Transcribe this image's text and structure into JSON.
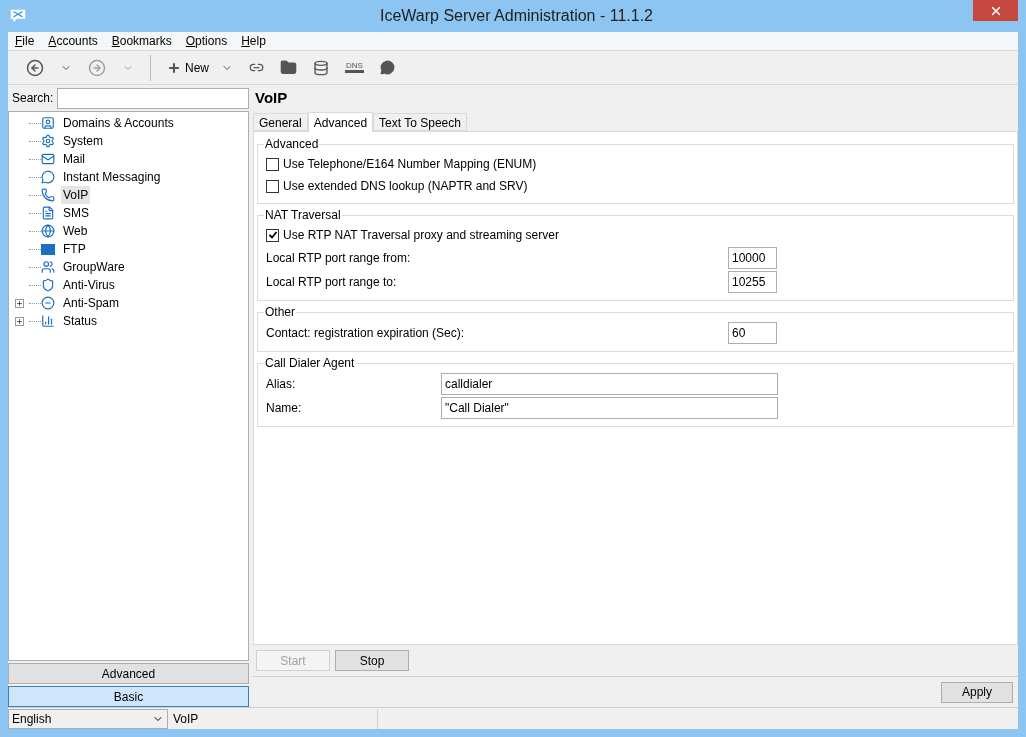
{
  "window": {
    "title": "IceWarp Server Administration - 11.1.2"
  },
  "menu": [
    "File",
    "Accounts",
    "Bookmarks",
    "Options",
    "Help"
  ],
  "toolbar": [
    {
      "kind": "back",
      "disabled": false
    },
    {
      "kind": "dropdown",
      "disabled": false
    },
    {
      "kind": "forward",
      "disabled": true
    },
    {
      "kind": "dropdown",
      "disabled": true
    },
    {
      "kind": "separator"
    },
    {
      "kind": "new",
      "label": "New",
      "disabled": false
    },
    {
      "kind": "dropdown",
      "disabled": false
    },
    {
      "kind": "link",
      "disabled": false
    },
    {
      "kind": "folder",
      "disabled": false
    },
    {
      "kind": "database",
      "disabled": false
    },
    {
      "kind": "dns",
      "label": "DNS",
      "disabled": false
    },
    {
      "kind": "chat",
      "disabled": false
    }
  ],
  "search": {
    "label": "Search:"
  },
  "tree": [
    {
      "label": "Domains & Accounts",
      "selected": false
    },
    {
      "label": "System",
      "selected": false
    },
    {
      "label": "Mail",
      "selected": false
    },
    {
      "label": "Instant Messaging",
      "selected": false
    },
    {
      "label": "VoIP",
      "selected": true
    },
    {
      "label": "SMS",
      "selected": false
    },
    {
      "label": "Web",
      "selected": false
    },
    {
      "label": "FTP",
      "selected": false
    },
    {
      "label": "GroupWare",
      "selected": false
    },
    {
      "label": "Anti-Virus",
      "selected": false
    },
    {
      "label": "Anti-Spam",
      "selected": false,
      "expanded": false
    },
    {
      "label": "Status",
      "selected": false,
      "expanded": false
    }
  ],
  "mode_buttons": [
    {
      "label": "Advanced",
      "selected": false
    },
    {
      "label": "Basic",
      "selected": true
    }
  ],
  "page": {
    "title": "VoIP",
    "tabs": [
      {
        "label": "General",
        "selected": false
      },
      {
        "label": "Advanced",
        "selected": true
      },
      {
        "label": "Text To Speech",
        "selected": false
      }
    ],
    "groups": [
      {
        "title": "Advanced",
        "rows": [
          {
            "kind": "checkbox",
            "label": "Use Telephone/E164 Number Mapping (ENUM)",
            "checked": false
          },
          {
            "kind": "checkbox",
            "label": "Use extended DNS lookup (NAPTR and SRV)",
            "checked": false
          }
        ]
      },
      {
        "title": "NAT Traversal",
        "rows": [
          {
            "kind": "checkbox",
            "label": "Use RTP NAT Traversal proxy and streaming server",
            "checked": true
          },
          {
            "kind": "number",
            "label": "Local RTP port range from:",
            "value": "10000"
          },
          {
            "kind": "number",
            "label": "Local RTP port range to:",
            "value": "10255"
          }
        ]
      },
      {
        "title": "Other",
        "rows": [
          {
            "kind": "number",
            "label": "Contact: registration expiration (Sec):",
            "value": "60"
          }
        ]
      },
      {
        "title": "Call Dialer Agent",
        "rows": [
          {
            "kind": "text",
            "label": "Alias:",
            "value": "calldialer"
          },
          {
            "kind": "text",
            "label": "Name:",
            "value": "\"Call Dialer\""
          }
        ]
      }
    ],
    "actions": [
      {
        "label": "Start",
        "disabled": true
      },
      {
        "label": "Stop",
        "disabled": false
      }
    ],
    "apply": "Apply"
  },
  "status_bar": {
    "language": "English",
    "section": "VoIP"
  }
}
